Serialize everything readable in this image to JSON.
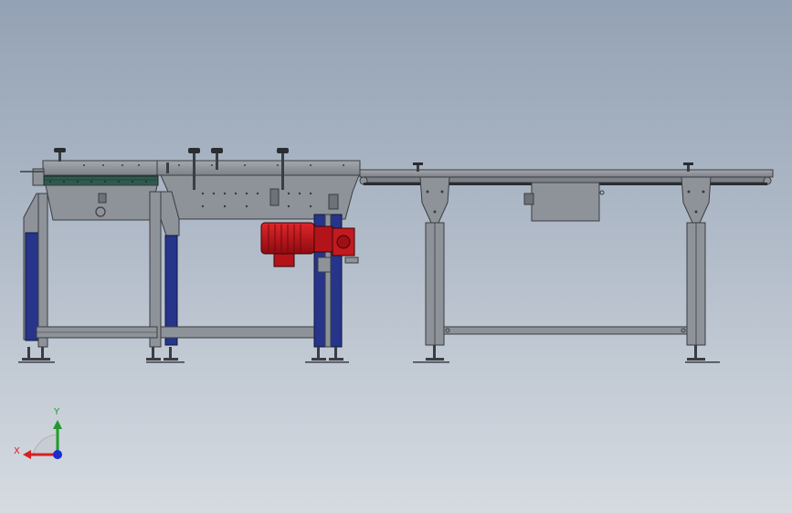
{
  "triad": {
    "x_label": "X",
    "y_label": "Y"
  },
  "colors": {
    "frame": "#8e9399",
    "frame_dark": "#3a3d42",
    "leg_blue": "#26358a",
    "motor_red": "#c8141a",
    "belt_green": "#2f5a4e",
    "axis_x": "#d62020",
    "axis_y": "#1f9a2a",
    "axis_z": "#1a2bd0"
  }
}
